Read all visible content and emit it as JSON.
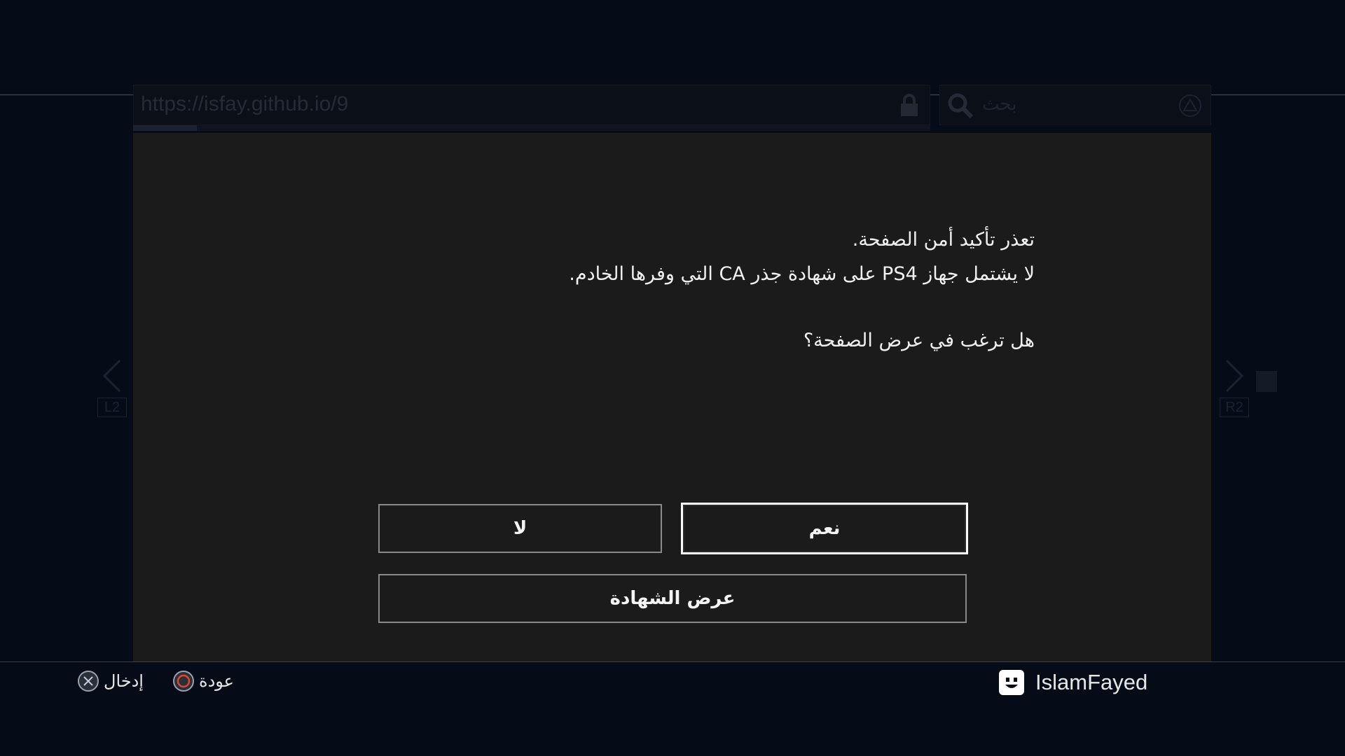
{
  "browser": {
    "url": "https://isfay.github.io/9",
    "search_placeholder": "بحث",
    "load_progress": 0.08,
    "nav_left_label": "L2",
    "nav_right_label": "R2"
  },
  "dialog": {
    "line1": "تعذر تأكيد أمن الصفحة.",
    "line2": "لا يشتمل جهاز PS4 على شهادة جذر CA التي وفرها الخادم.",
    "question": "هل ترغب في عرض الصفحة؟",
    "no_label": "لا",
    "yes_label": "نعم",
    "cert_label": "عرض الشهادة"
  },
  "footer": {
    "enter_label": "إدخال",
    "back_label": "عودة",
    "username": "IslamFayed"
  },
  "colors": {
    "background": "#060b18",
    "dialog": "#1b1b1b",
    "focus_border": "#ffffff",
    "circle_button": "#e0462e"
  }
}
